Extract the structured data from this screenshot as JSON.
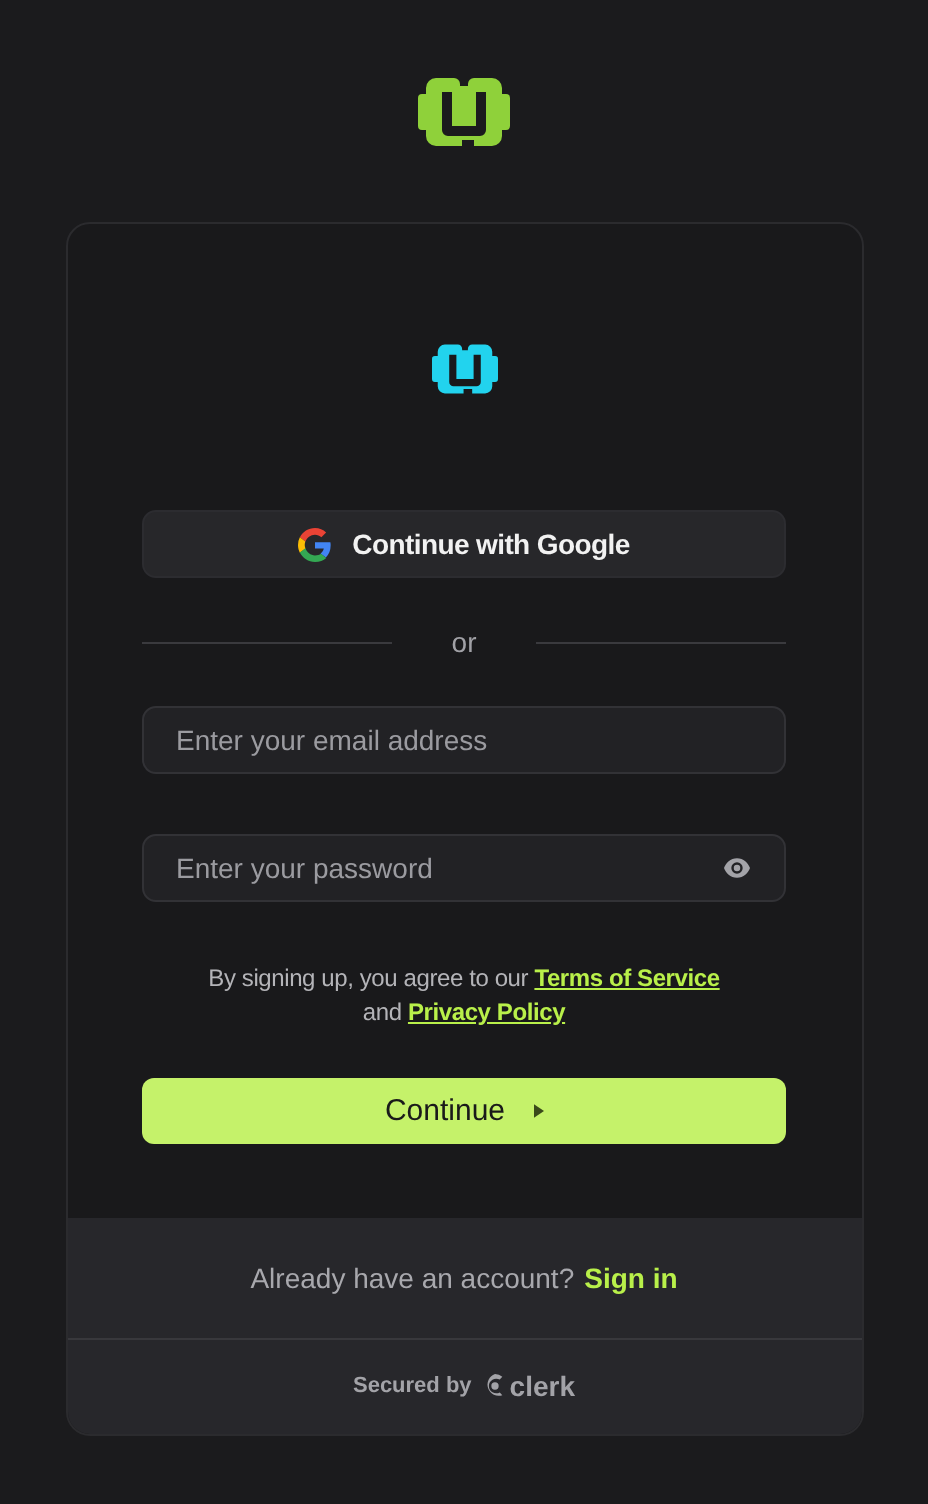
{
  "google_button": {
    "label": "Continue with Google"
  },
  "divider": {
    "label": "or"
  },
  "email": {
    "placeholder": "Enter your email address"
  },
  "password": {
    "placeholder": "Enter your password"
  },
  "legal": {
    "text": "By signing up, you agree to our",
    "terms_link": "Terms of Service",
    "joiner": "and",
    "privacy_link": "Privacy Policy"
  },
  "continue_button": {
    "label": "Continue"
  },
  "footer": {
    "prompt": "Already have an account?",
    "link": "Sign in"
  },
  "secured": {
    "label": "Secured by",
    "brand": "clerk"
  }
}
